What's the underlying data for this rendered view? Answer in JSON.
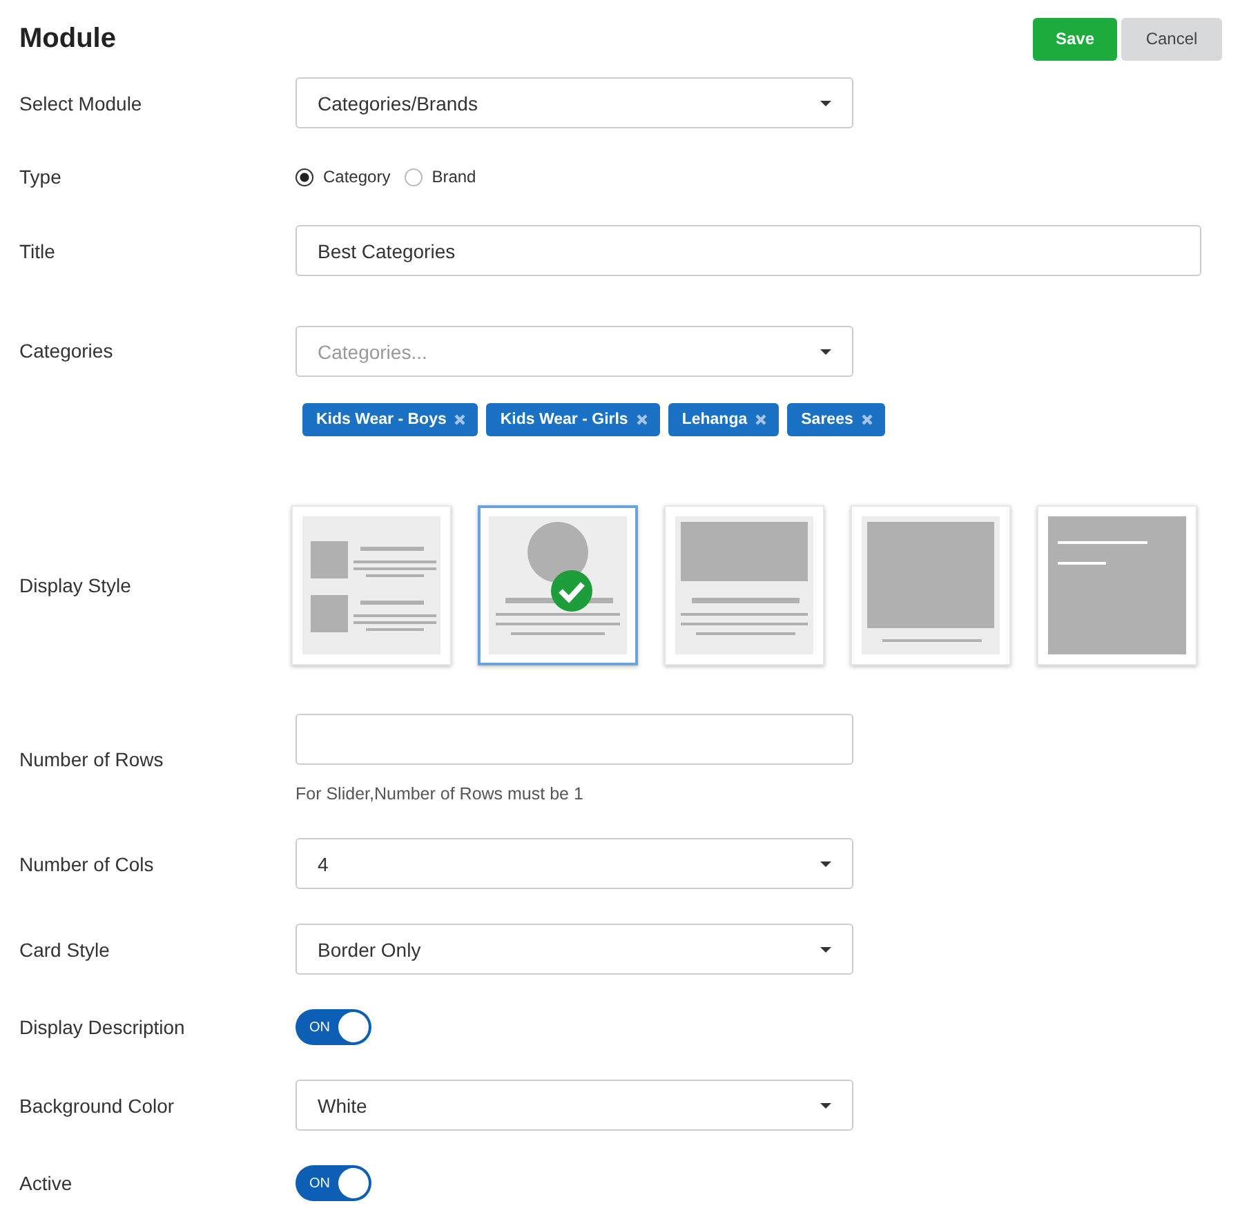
{
  "header": {
    "title": "Module",
    "buttons": [
      {
        "label": "Save",
        "kind": "primary"
      },
      {
        "label": "Cancel",
        "kind": "secondary"
      }
    ]
  },
  "fields": [
    {
      "kind": "select",
      "label": "Select Module",
      "value": "Categories/Brands"
    },
    {
      "kind": "radio",
      "label": "Type",
      "options": [
        {
          "label": "Category",
          "selected": true
        },
        {
          "label": "Brand",
          "selected": false
        }
      ]
    },
    {
      "kind": "text",
      "label": "Title",
      "value": "Best Categories",
      "wide": true
    },
    {
      "kind": "tags",
      "label": "Categories",
      "placeholder": "Categories...",
      "tags": [
        "Kids Wear - Boys",
        "Kids Wear - Girls",
        "Lehanga",
        "Sarees"
      ]
    },
    {
      "kind": "styles",
      "label": "Display Style",
      "styles": [
        {
          "kind": "list",
          "selected": false
        },
        {
          "kind": "circle",
          "selected": true
        },
        {
          "kind": "banner",
          "selected": false
        },
        {
          "kind": "image",
          "selected": false
        },
        {
          "kind": "overlay",
          "selected": false
        }
      ]
    },
    {
      "kind": "text",
      "label": "Number of Rows",
      "hint": "For Slider,Number of Rows must be 1"
    },
    {
      "kind": "select",
      "label": "Number of Cols",
      "value": "4"
    },
    {
      "kind": "select",
      "label": "Card Style",
      "value": "Border Only"
    },
    {
      "kind": "toggle",
      "label": "Display Description",
      "on": true,
      "text": "ON"
    },
    {
      "kind": "select",
      "label": "Background Color",
      "value": "White"
    },
    {
      "kind": "toggle",
      "label": "Active",
      "on": true,
      "text": "ON"
    }
  ]
}
